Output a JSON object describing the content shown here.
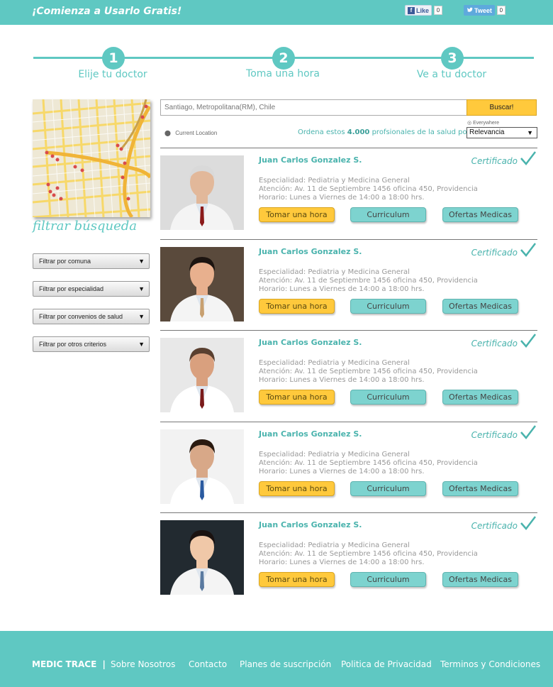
{
  "topbar": {
    "promo": "¡Comienza a Usarlo Gratis!",
    "facebook_label": "Like",
    "facebook_count": "0",
    "tweet_label": "Tweet",
    "tweet_count": "0"
  },
  "steps": [
    {
      "number": "1",
      "label": "Elije tu doctor"
    },
    {
      "number": "2",
      "label": "Toma una hora"
    },
    {
      "number": "3",
      "label": "Ve a tu doctor"
    }
  ],
  "sidebar": {
    "filter_title": "filtrar búsqueda",
    "filters": [
      "Filtrar por comuna",
      "Filtrar por especialidad",
      "Filtrar por convenios de salud",
      "Filtrar por otros criterios"
    ]
  },
  "search": {
    "value": "Santiago, Metropolitana(RM), Chile",
    "button": "Buscar!",
    "current_location": "Current Location",
    "everywhere": "Everywhere",
    "order_prefix": "Ordena estos",
    "order_count": "4.000",
    "order_suffix": "profsionales de la salud por:",
    "sort_value": "Relevancia"
  },
  "colors": {
    "accent": "#5fc8c2",
    "button_yellow": "#ffc93c",
    "button_teal": "#7dd3cf"
  },
  "doctors": [
    {
      "name": "Juan Carlos Gonzalez S.",
      "certified": "Certificado",
      "specialty": "Especialidad: Pediatria y Medicina General",
      "address": "Atención: Av. 11 de Septiembre 1456 oficina 450, Providencia",
      "hours": "Horario: Lunes a Viernes de 14:00 a 18:00 hrs.",
      "btn_hour": "Tomar una hora",
      "btn_cv": "Curriculum",
      "btn_offers": "Ofertas Medicas"
    },
    {
      "name": "Juan Carlos Gonzalez S.",
      "certified": "Certificado",
      "specialty": "Especialidad: Pediatria y Medicina General",
      "address": "Atención: Av. 11 de Septiembre 1456 oficina 450, Providencia",
      "hours": "Horario: Lunes a Viernes de 14:00 a 18:00 hrs.",
      "btn_hour": "Tomar una hora",
      "btn_cv": "Curriculum",
      "btn_offers": "Ofertas Medicas"
    },
    {
      "name": "Juan Carlos Gonzalez S.",
      "certified": "Certificado",
      "specialty": "Especialidad: Pediatria y Medicina General",
      "address": "Atención: Av. 11 de Septiembre 1456 oficina 450, Providencia",
      "hours": "Horario: Lunes a Viernes de 14:00 a 18:00 hrs.",
      "btn_hour": "Tomar una hora",
      "btn_cv": "Curriculum",
      "btn_offers": "Ofertas Medicas"
    },
    {
      "name": "Juan Carlos Gonzalez S.",
      "certified": "Certificado",
      "specialty": "Especialidad: Pediatria y Medicina General",
      "address": "Atención: Av. 11 de Septiembre 1456 oficina 450, Providencia",
      "hours": "Horario: Lunes a Viernes de 14:00 a 18:00 hrs.",
      "btn_hour": "Tomar una hora",
      "btn_cv": "Curriculum",
      "btn_offers": "Ofertas Medicas"
    },
    {
      "name": "Juan Carlos Gonzalez S.",
      "certified": "Certificado",
      "specialty": "Especialidad: Pediatria y Medicina General",
      "address": "Atención: Av. 11 de Septiembre 1456 oficina 450, Providencia",
      "hours": "Horario: Lunes a Viernes de 14:00 a 18:00 hrs.",
      "btn_hour": "Tomar una hora",
      "btn_cv": "Curriculum",
      "btn_offers": "Ofertas Medicas"
    }
  ],
  "footer": {
    "brand": "MEDIC TRACE",
    "separator": "|",
    "links": [
      "Sobre Nosotros",
      "Contacto",
      "Planes de suscripción",
      "Politica de Privacidad",
      "Terminos y Condiciones"
    ]
  }
}
